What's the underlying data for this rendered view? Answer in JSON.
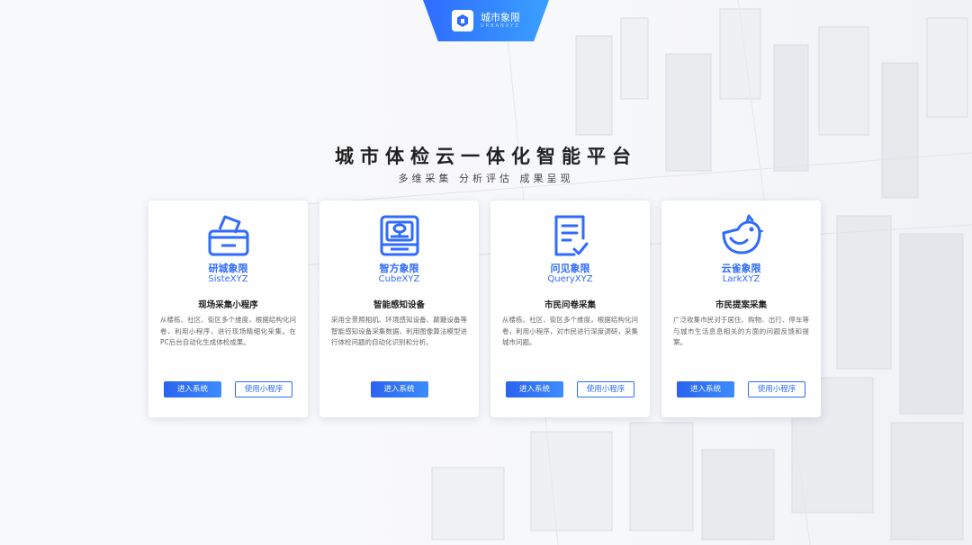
{
  "header": {
    "brand_name": "城市象限",
    "brand_sub": "URBANXYZ"
  },
  "hero": {
    "title": "城市体检云一体化智能平台",
    "subtitle": "多维采集  分析评估  成果呈现"
  },
  "cards": [
    {
      "icon": "ballot-box-icon",
      "name": "研城象限",
      "en": "SisteXYZ",
      "title": "现场采集小程序",
      "desc": "从楼栋、社区、街区多个维度，根据结构化问卷，利用小程序，进行现场精细化采集。在PC后台自动化生成体检成果。",
      "primary": "进入系统",
      "secondary": "使用小程序"
    },
    {
      "icon": "device-box-icon",
      "name": "智方象限",
      "en": "CubeXYZ",
      "title": "智能感知设备",
      "desc": "采用全景照相机、环境感知设备、颠簸设备等智能感知设备采集数据，利用图像算法模型进行体检问题的自动化识别和分析。",
      "primary": "进入系统",
      "secondary": ""
    },
    {
      "icon": "checklist-icon",
      "name": "问见象限",
      "en": "QueryXYZ",
      "title": "市民问卷采集",
      "desc": "从楼栋、社区、街区多个维度，根据结构化问卷，利用小程序，对市民进行深度调研，采集城市问题。",
      "primary": "进入系统",
      "secondary": "使用小程序"
    },
    {
      "icon": "bird-icon",
      "name": "云雀象限",
      "en": "LarkXYZ",
      "title": "市民提案采集",
      "desc": "广泛收集市民对于居住、购物、出行、停车等与城市生活息息相关的方面的问题反馈和提案。",
      "primary": "进入系统",
      "secondary": "使用小程序"
    }
  ],
  "colors": {
    "accent": "#2f6bff",
    "background": "#f7f8fa"
  }
}
